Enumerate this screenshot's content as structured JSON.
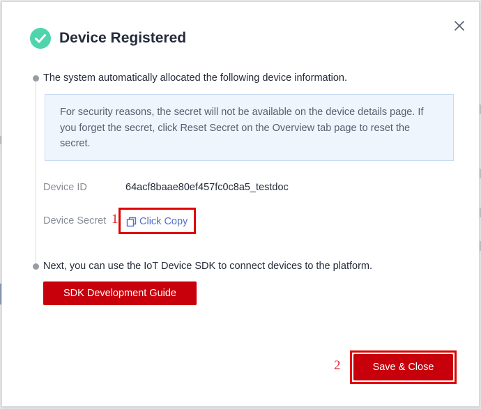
{
  "dialog": {
    "title": "Device Registered",
    "close_icon": "close-icon",
    "status_icon": "success-check-icon",
    "status_color": "#50d4ab"
  },
  "step1": {
    "text": "The system automatically allocated the following device information.",
    "notice": "For security reasons, the secret will not be available on the device details page. If you forget the secret, click Reset Secret on the Overview tab page to reset the secret.",
    "device_id_label": "Device ID",
    "device_id_value": "64acf8baae80ef457fc0c8a5_testdoc",
    "device_secret_label": "Device Secret",
    "copy_label": "Click Copy",
    "copy_icon": "copy-icon"
  },
  "step2": {
    "text": "Next, you can use the IoT Device SDK to connect devices to the platform.",
    "sdk_button_label": "SDK Development Guide"
  },
  "footer": {
    "save_close_label": "Save & Close"
  },
  "annotations": {
    "marker1": "1",
    "marker2": "2"
  },
  "colors": {
    "primary_red": "#c7000b",
    "link_blue": "#526ecc",
    "highlight_red": "#e00000"
  }
}
